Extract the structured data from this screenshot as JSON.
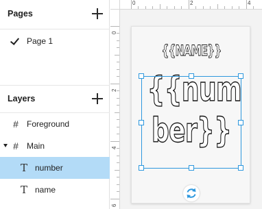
{
  "pages_panel": {
    "title": "Pages",
    "add_icon": "plus-icon",
    "items": [
      {
        "label": "Page 1",
        "icon": "check-icon",
        "active": true
      }
    ]
  },
  "layers_panel": {
    "title": "Layers",
    "add_icon": "plus-icon",
    "items": [
      {
        "label": "Foreground",
        "icon": "frame-icon",
        "selected": false
      },
      {
        "label": "Main",
        "icon": "frame-icon",
        "expanded": true,
        "selected": false
      },
      {
        "label": "number",
        "icon": "text-layer-icon",
        "selected": true
      },
      {
        "label": "name",
        "icon": "text-layer-icon",
        "selected": false
      }
    ]
  },
  "ruler": {
    "top_labels": [
      "0",
      "2",
      "4"
    ],
    "left_labels": [
      "0",
      "2",
      "4",
      "6"
    ]
  },
  "canvas": {
    "name_text": "{{NAME}}",
    "number_line1": "{{num",
    "number_line2": "ber}}",
    "rotate_icon": "rotate-icon"
  },
  "colors": {
    "selection": "#2c97de",
    "selected_row": "#b3dbf7",
    "canvas_bg": "#f3f3f3"
  }
}
